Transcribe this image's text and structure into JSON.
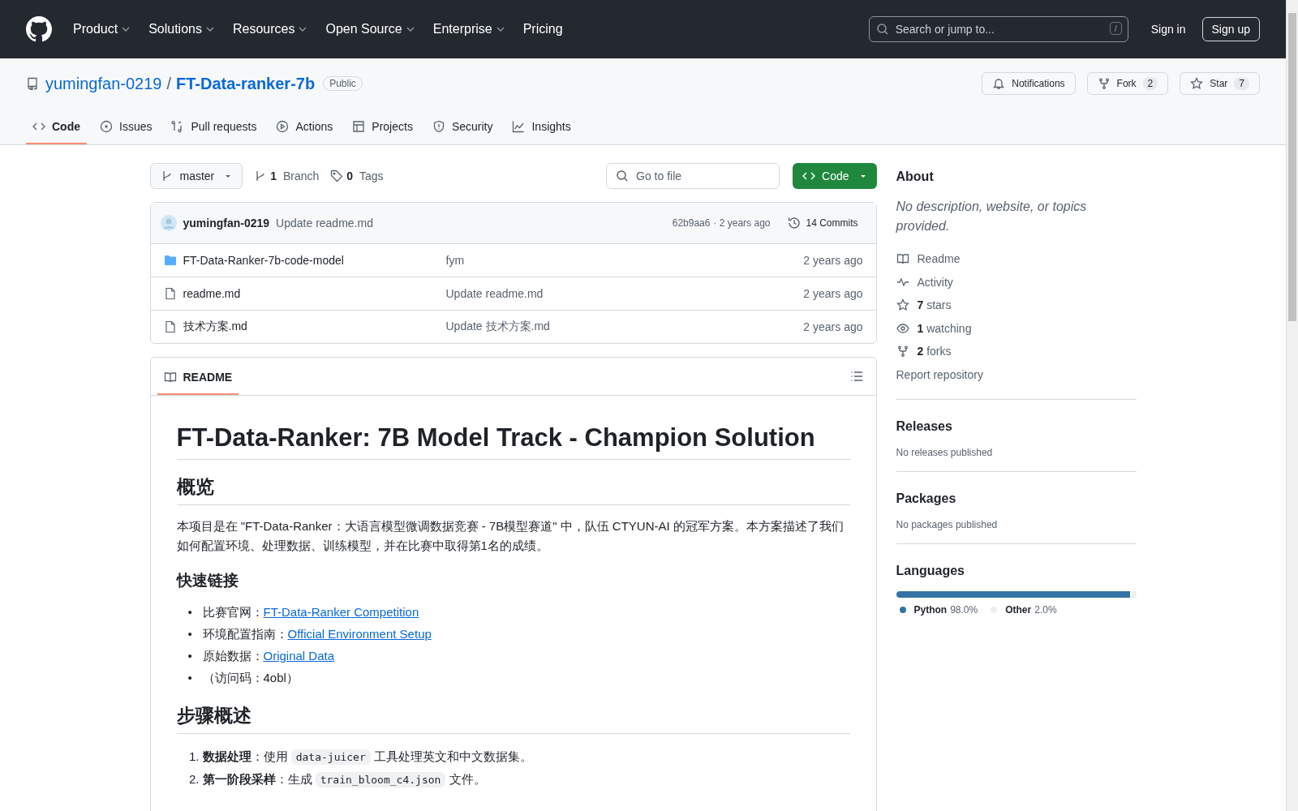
{
  "top_nav": {
    "items": [
      {
        "label": "Product",
        "dropdown": true
      },
      {
        "label": "Solutions",
        "dropdown": true
      },
      {
        "label": "Resources",
        "dropdown": true
      },
      {
        "label": "Open Source",
        "dropdown": true
      },
      {
        "label": "Enterprise",
        "dropdown": true
      },
      {
        "label": "Pricing",
        "dropdown": false
      }
    ],
    "search": {
      "placeholder": "Search or jump to...",
      "shortcut": "/"
    },
    "sign_in": "Sign in",
    "sign_up": "Sign up"
  },
  "repo": {
    "owner": "yumingfan-0219",
    "separator": "/",
    "name": "FT-Data-ranker-7b",
    "visibility": "Public",
    "actions": [
      {
        "kind": "bell",
        "label": "Notifications"
      },
      {
        "kind": "fork",
        "label": "Fork",
        "count": "2"
      },
      {
        "kind": "star",
        "label": "Star",
        "count": "7"
      }
    ]
  },
  "tabs": [
    {
      "kind": "code",
      "label": "Code",
      "selected": true
    },
    {
      "kind": "issues",
      "label": "Issues",
      "selected": false
    },
    {
      "kind": "pulls",
      "label": "Pull requests",
      "selected": false
    },
    {
      "kind": "actions",
      "label": "Actions",
      "selected": false
    },
    {
      "kind": "projects",
      "label": "Projects",
      "selected": false
    },
    {
      "kind": "security",
      "label": "Security",
      "selected": false
    },
    {
      "kind": "insights",
      "label": "Insights",
      "selected": false
    }
  ],
  "toolbar": {
    "branch": "master",
    "branches": {
      "count": "1",
      "label": "Branch"
    },
    "tags": {
      "count": "0",
      "label": "Tags"
    },
    "file_search": {
      "placeholder": "Go to file"
    },
    "code_button": "Code"
  },
  "latest_commit": {
    "author": "yumingfan-0219",
    "message": "Update readme.md",
    "hash": "62b9aa6",
    "time": "· 2 years ago",
    "commits": "14 Commits"
  },
  "files": [
    {
      "kind": "folder",
      "name": "FT-Data-Ranker-7b-code-model",
      "message": "fym",
      "time": "2 years ago"
    },
    {
      "kind": "file",
      "name": "readme.md",
      "message": "Update readme.md",
      "time": "2 years ago"
    },
    {
      "kind": "file",
      "name": "技术方案.md",
      "message": "Update 技术方案.md",
      "time": "2 years ago"
    }
  ],
  "readme": {
    "tab": "README",
    "title": "FT-Data-Ranker: 7B Model Track - Champion Solution",
    "overview_heading": "概览",
    "overview": "本项目是在 \"FT-Data-Ranker：大语言模型微调数据竞赛 - 7B模型赛道\" 中，队伍 CTYUN-AI 的冠军方案。本方案描述了我们如何配置环境、处理数据、训练模型，并在比赛中取得第1名的成绩。",
    "links_heading": "快速链接",
    "links": [
      {
        "marker": "•",
        "label": "比赛官网：",
        "link": "FT-Data-Ranker Competition"
      },
      {
        "marker": "•",
        "label": "环境配置指南：",
        "link": "Official Environment Setup"
      },
      {
        "marker": "•",
        "label": "原始数据：",
        "link": "Original Data"
      },
      {
        "marker": "•",
        "label": "（访问码：4obl）"
      }
    ],
    "steps_heading": "步骤概述",
    "steps": [
      {
        "marker": "1.",
        "bold": "数据处理",
        "before": "：使用 ",
        "code": "data-juicer",
        "after": " 工具处理英文和中文数据集。"
      },
      {
        "marker": "2.",
        "bold": "第一阶段采样",
        "before": "：生成 ",
        "code": "train_bloom_c4.json",
        "after": " 文件。"
      }
    ]
  },
  "about": {
    "heading": "About",
    "description": "No description, website, or topics provided.",
    "items": [
      {
        "kind": "book",
        "label": "Readme"
      },
      {
        "kind": "pulse",
        "label": "Activity"
      },
      {
        "kind": "star",
        "count": "7",
        "label": "stars"
      },
      {
        "kind": "eye",
        "count": "1",
        "label": "watching"
      },
      {
        "kind": "fork",
        "count": "2",
        "label": "forks"
      }
    ],
    "report": "Report repository"
  },
  "releases": {
    "heading": "Releases",
    "note": "No releases published"
  },
  "packages": {
    "heading": "Packages",
    "note": "No packages published"
  },
  "languages": {
    "heading": "Languages",
    "items": [
      {
        "name": "Python",
        "percent": "98.0%",
        "color": "#3572a5",
        "level": 0.98
      },
      {
        "name": "Other",
        "percent": "2.0%",
        "color": "#ededed",
        "level": 0.02
      }
    ]
  }
}
